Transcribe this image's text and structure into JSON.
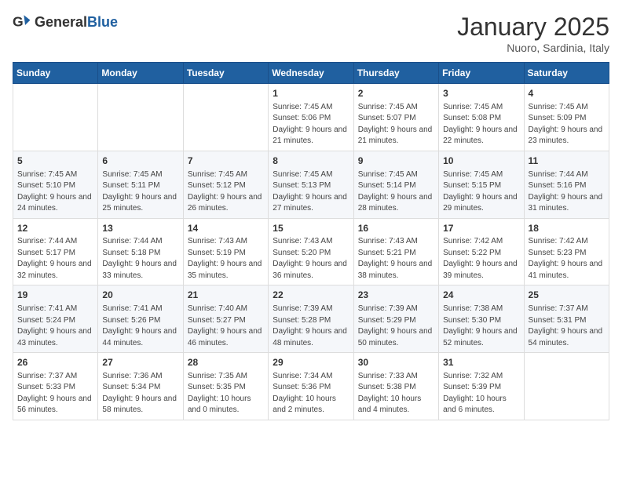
{
  "logo": {
    "general": "General",
    "blue": "Blue"
  },
  "title": "January 2025",
  "subtitle": "Nuoro, Sardinia, Italy",
  "weekdays": [
    "Sunday",
    "Monday",
    "Tuesday",
    "Wednesday",
    "Thursday",
    "Friday",
    "Saturday"
  ],
  "weeks": [
    [
      {
        "day": "",
        "info": ""
      },
      {
        "day": "",
        "info": ""
      },
      {
        "day": "",
        "info": ""
      },
      {
        "day": "1",
        "info": "Sunrise: 7:45 AM\nSunset: 5:06 PM\nDaylight: 9 hours and 21 minutes."
      },
      {
        "day": "2",
        "info": "Sunrise: 7:45 AM\nSunset: 5:07 PM\nDaylight: 9 hours and 21 minutes."
      },
      {
        "day": "3",
        "info": "Sunrise: 7:45 AM\nSunset: 5:08 PM\nDaylight: 9 hours and 22 minutes."
      },
      {
        "day": "4",
        "info": "Sunrise: 7:45 AM\nSunset: 5:09 PM\nDaylight: 9 hours and 23 minutes."
      }
    ],
    [
      {
        "day": "5",
        "info": "Sunrise: 7:45 AM\nSunset: 5:10 PM\nDaylight: 9 hours and 24 minutes."
      },
      {
        "day": "6",
        "info": "Sunrise: 7:45 AM\nSunset: 5:11 PM\nDaylight: 9 hours and 25 minutes."
      },
      {
        "day": "7",
        "info": "Sunrise: 7:45 AM\nSunset: 5:12 PM\nDaylight: 9 hours and 26 minutes."
      },
      {
        "day": "8",
        "info": "Sunrise: 7:45 AM\nSunset: 5:13 PM\nDaylight: 9 hours and 27 minutes."
      },
      {
        "day": "9",
        "info": "Sunrise: 7:45 AM\nSunset: 5:14 PM\nDaylight: 9 hours and 28 minutes."
      },
      {
        "day": "10",
        "info": "Sunrise: 7:45 AM\nSunset: 5:15 PM\nDaylight: 9 hours and 29 minutes."
      },
      {
        "day": "11",
        "info": "Sunrise: 7:44 AM\nSunset: 5:16 PM\nDaylight: 9 hours and 31 minutes."
      }
    ],
    [
      {
        "day": "12",
        "info": "Sunrise: 7:44 AM\nSunset: 5:17 PM\nDaylight: 9 hours and 32 minutes."
      },
      {
        "day": "13",
        "info": "Sunrise: 7:44 AM\nSunset: 5:18 PM\nDaylight: 9 hours and 33 minutes."
      },
      {
        "day": "14",
        "info": "Sunrise: 7:43 AM\nSunset: 5:19 PM\nDaylight: 9 hours and 35 minutes."
      },
      {
        "day": "15",
        "info": "Sunrise: 7:43 AM\nSunset: 5:20 PM\nDaylight: 9 hours and 36 minutes."
      },
      {
        "day": "16",
        "info": "Sunrise: 7:43 AM\nSunset: 5:21 PM\nDaylight: 9 hours and 38 minutes."
      },
      {
        "day": "17",
        "info": "Sunrise: 7:42 AM\nSunset: 5:22 PM\nDaylight: 9 hours and 39 minutes."
      },
      {
        "day": "18",
        "info": "Sunrise: 7:42 AM\nSunset: 5:23 PM\nDaylight: 9 hours and 41 minutes."
      }
    ],
    [
      {
        "day": "19",
        "info": "Sunrise: 7:41 AM\nSunset: 5:24 PM\nDaylight: 9 hours and 43 minutes."
      },
      {
        "day": "20",
        "info": "Sunrise: 7:41 AM\nSunset: 5:26 PM\nDaylight: 9 hours and 44 minutes."
      },
      {
        "day": "21",
        "info": "Sunrise: 7:40 AM\nSunset: 5:27 PM\nDaylight: 9 hours and 46 minutes."
      },
      {
        "day": "22",
        "info": "Sunrise: 7:39 AM\nSunset: 5:28 PM\nDaylight: 9 hours and 48 minutes."
      },
      {
        "day": "23",
        "info": "Sunrise: 7:39 AM\nSunset: 5:29 PM\nDaylight: 9 hours and 50 minutes."
      },
      {
        "day": "24",
        "info": "Sunrise: 7:38 AM\nSunset: 5:30 PM\nDaylight: 9 hours and 52 minutes."
      },
      {
        "day": "25",
        "info": "Sunrise: 7:37 AM\nSunset: 5:31 PM\nDaylight: 9 hours and 54 minutes."
      }
    ],
    [
      {
        "day": "26",
        "info": "Sunrise: 7:37 AM\nSunset: 5:33 PM\nDaylight: 9 hours and 56 minutes."
      },
      {
        "day": "27",
        "info": "Sunrise: 7:36 AM\nSunset: 5:34 PM\nDaylight: 9 hours and 58 minutes."
      },
      {
        "day": "28",
        "info": "Sunrise: 7:35 AM\nSunset: 5:35 PM\nDaylight: 10 hours and 0 minutes."
      },
      {
        "day": "29",
        "info": "Sunrise: 7:34 AM\nSunset: 5:36 PM\nDaylight: 10 hours and 2 minutes."
      },
      {
        "day": "30",
        "info": "Sunrise: 7:33 AM\nSunset: 5:38 PM\nDaylight: 10 hours and 4 minutes."
      },
      {
        "day": "31",
        "info": "Sunrise: 7:32 AM\nSunset: 5:39 PM\nDaylight: 10 hours and 6 minutes."
      },
      {
        "day": "",
        "info": ""
      }
    ]
  ]
}
